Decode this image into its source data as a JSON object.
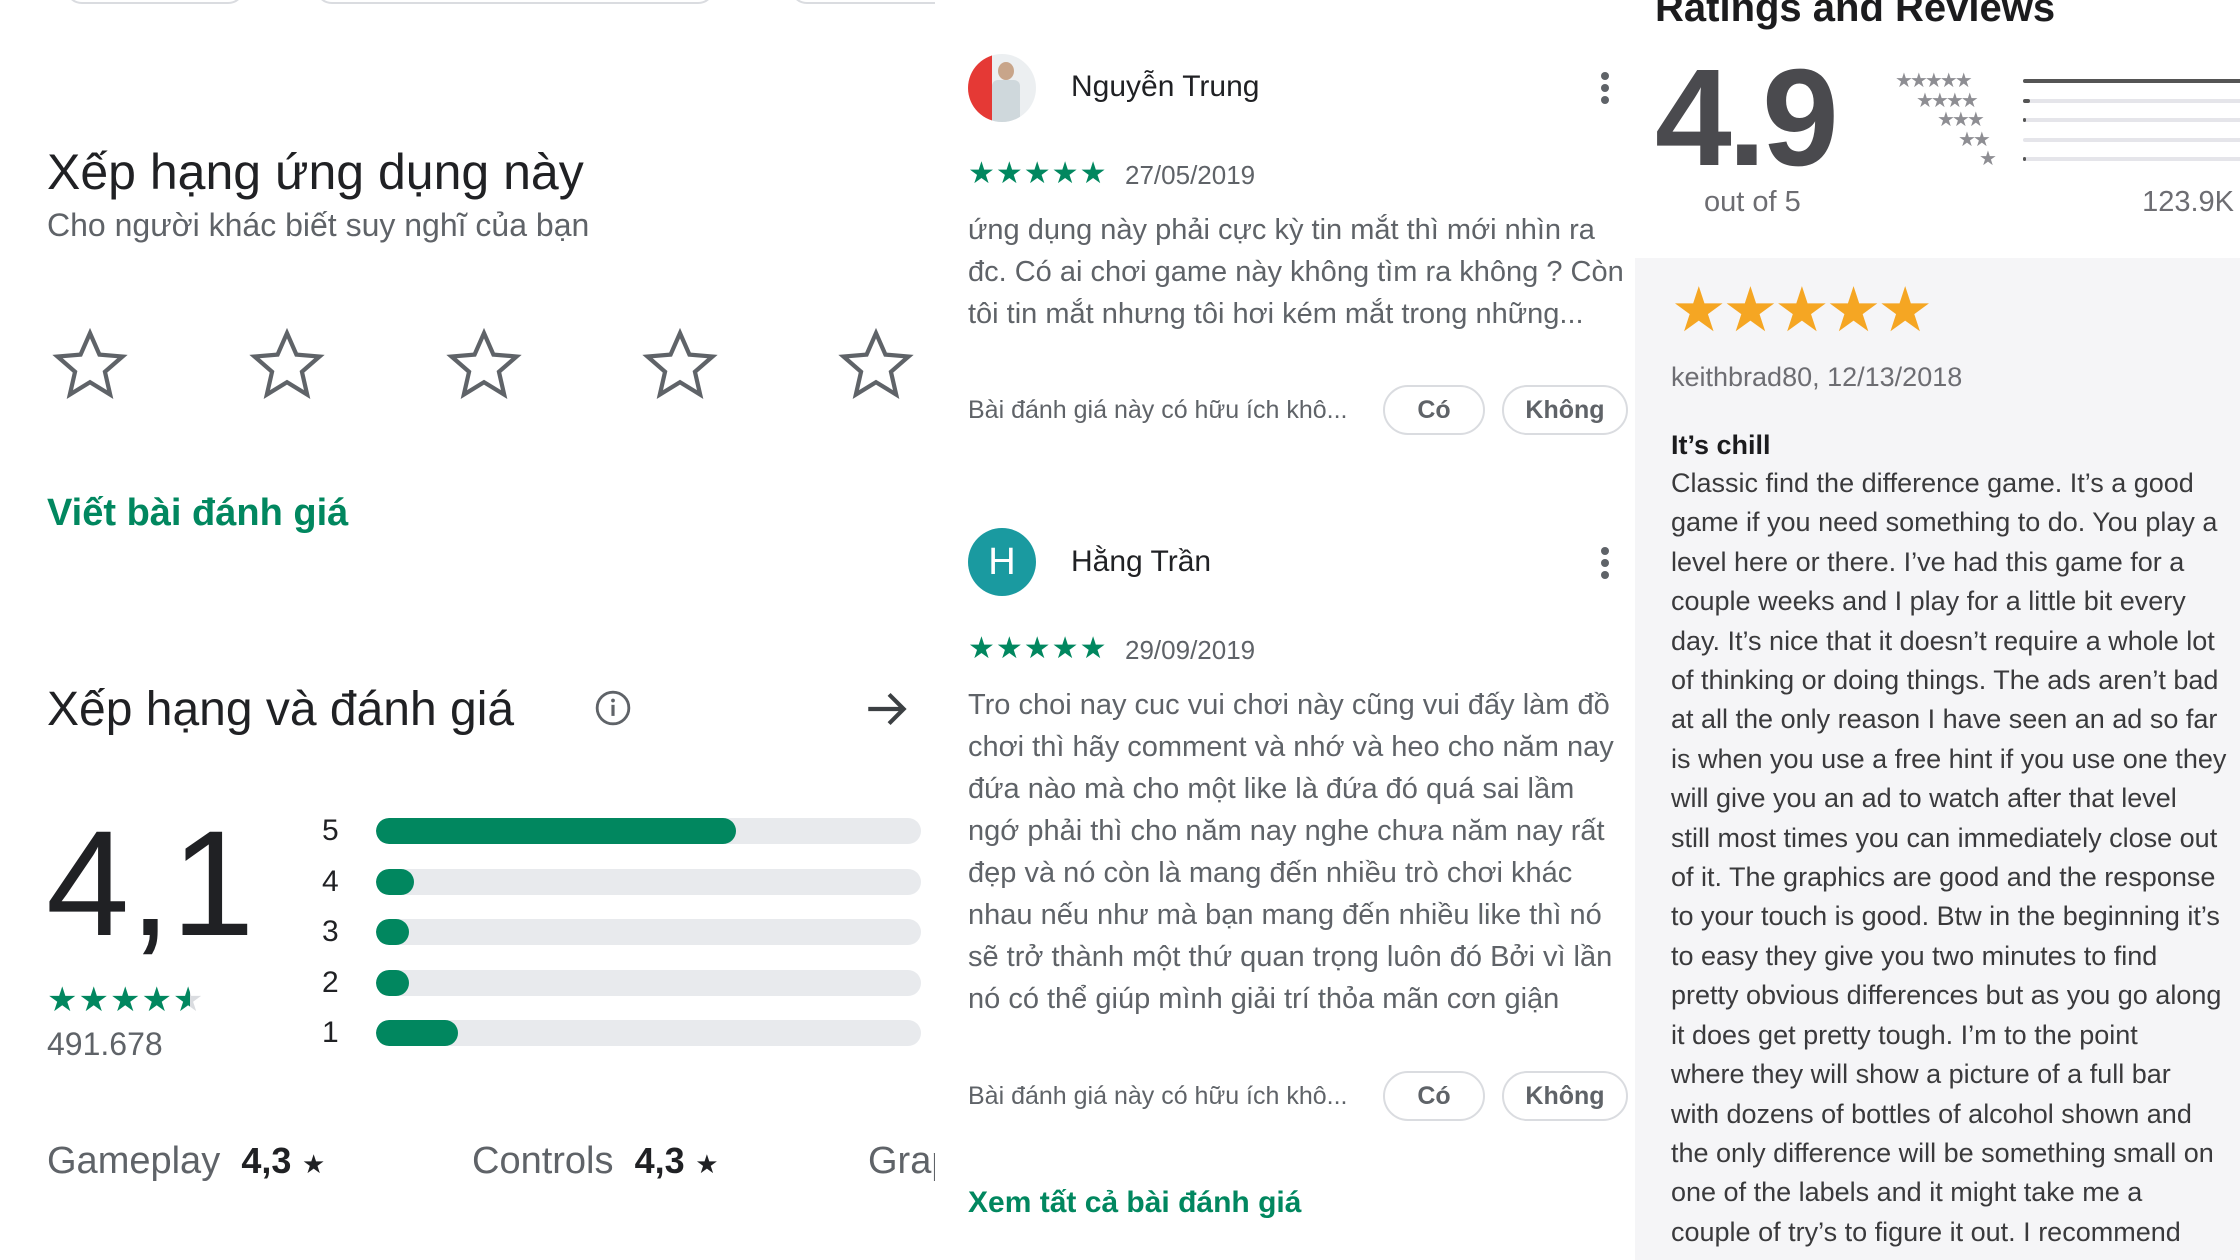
{
  "left": {
    "rate_title": "Xếp hạng ứng dụng này",
    "rate_subtitle": "Cho người khác biết suy nghĩ của bạn",
    "write_review": "Viết bài đánh giá",
    "ratings_title": "Xếp hạng và đánh giá",
    "average": "4,1",
    "average_stars": 4.5,
    "count": "491.678",
    "distribution": [
      {
        "label": "5",
        "fraction": 0.66
      },
      {
        "label": "4",
        "fraction": 0.07
      },
      {
        "label": "3",
        "fraction": 0.06
      },
      {
        "label": "2",
        "fraction": 0.05
      },
      {
        "label": "1",
        "fraction": 0.15
      }
    ],
    "attributes": [
      {
        "name": "Gameplay",
        "value": "4,3"
      },
      {
        "name": "Controls",
        "value": "4,3"
      },
      {
        "name": "Grap",
        "value": ""
      }
    ],
    "accent": "#01875f"
  },
  "middle": {
    "reviews": [
      {
        "name": "Nguyễn Trung",
        "avatar": "photo",
        "stars": 5,
        "date": "27/05/2019",
        "text": "ứng dụng này phải cực kỳ tin mắt thì mới nhìn ra đc. Có ai chơi game này không tìm ra không ? Còn tôi tin mắt nhưng tôi hơi kém mắt trong những...",
        "helpful": "Bài đánh giá này có hữu ích khô...",
        "yes": "Có",
        "no": "Không"
      },
      {
        "name": "Hằng Trần",
        "avatar": "H",
        "avatar_color": "#1a9aa0",
        "stars": 5,
        "date": "29/09/2019",
        "text": "Tro choi nay cuc vui chơi này cũng vui đấy làm đồ chơi thì hãy comment và nhớ và heo cho năm nay đứa nào mà cho một like là đứa đó quá sai lầm ngớ phải thì cho năm nay nghe chưa năm nay rất đẹp và nó còn là mang đến nhiều trò chơi khác nhau nếu như mà bạn mang đến nhiều like thì nó sẽ trở thành một thứ quan trọng luôn đó Bởi vì lần nó có thể giúp mình giải trí thỏa mãn cơn giận",
        "helpful": "Bài đánh giá này có hữu ích khô...",
        "yes": "Có",
        "no": "Không"
      }
    ],
    "see_all": "Xem tất cả bài đánh giá"
  },
  "right": {
    "title": "Ratings and Reviews",
    "average": "4.9",
    "out_of": "out of 5",
    "count": "123.9K",
    "distribution": [
      {
        "stars": 5,
        "fraction": 0.97
      },
      {
        "stars": 4,
        "fraction": 0.03
      },
      {
        "stars": 3,
        "fraction": 0.01
      },
      {
        "stars": 2,
        "fraction": 0.0
      },
      {
        "stars": 1,
        "fraction": 0.01
      }
    ],
    "review": {
      "stars": 5,
      "star_color": "#f5a623",
      "author_date": "keithbrad80, 12/13/2018",
      "title": "It’s chill",
      "lines": [
        "Classic find the difference game. It’s a good",
        "game if you need something to do. You play a",
        "level here or there. I’ve had this game for a",
        "couple weeks and I play for a little bit every",
        "day. It’s nice that it doesn’t require a whole lot",
        "of thinking or doing things. The ads aren’t bad",
        "at all the only reason I have seen an ad so far",
        "is when you use a free hint if you use one they",
        "will give you an ad to watch after that level",
        "still most times you can immediately close out",
        "of it. The graphics are good and the response",
        "to your touch is good. Btw in the beginning it’s",
        "to easy they give you two minutes to find",
        "pretty obvious differences but as you go along",
        "it does get pretty tough. I’m to the point",
        "where they will show a picture of a full bar",
        "with dozens of bottles of alcohol shown and",
        "the only difference will be something small on",
        "one of the labels and it might take me a",
        "couple of try’s to figure it out. I recommend"
      ]
    }
  }
}
